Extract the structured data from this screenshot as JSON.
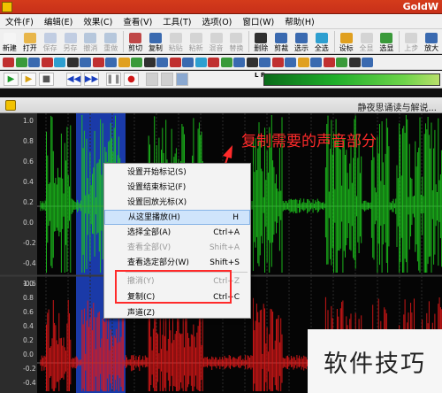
{
  "app": {
    "title": "GoldW"
  },
  "menu": [
    "文件(F)",
    "编辑(E)",
    "效果(C)",
    "查看(V)",
    "工具(T)",
    "选项(O)",
    "窗口(W)",
    "帮助(H)"
  ],
  "toolbar": [
    {
      "label": "新建",
      "enabled": true,
      "color": "#f5f5f5"
    },
    {
      "label": "打开",
      "enabled": true,
      "color": "#e8b64a"
    },
    {
      "label": "保存",
      "enabled": false,
      "color": "#6a8cc8"
    },
    {
      "label": "另存",
      "enabled": false,
      "color": "#6a8cc8"
    },
    {
      "label": "撤消",
      "enabled": false,
      "color": "#4a7ab8"
    },
    {
      "label": "重做",
      "enabled": false,
      "color": "#4a7ab8"
    },
    {
      "label": "剪切",
      "enabled": true,
      "color": "#c04848"
    },
    {
      "label": "复制",
      "enabled": true,
      "color": "#3a6ab0"
    },
    {
      "label": "粘贴",
      "enabled": false,
      "color": "#a0a0a0"
    },
    {
      "label": "粘新",
      "enabled": false,
      "color": "#a0a0a0"
    },
    {
      "label": "混音",
      "enabled": false,
      "color": "#a0a0a0"
    },
    {
      "label": "替换",
      "enabled": false,
      "color": "#a0a0a0"
    },
    {
      "label": "删除",
      "enabled": true,
      "color": "#303030"
    },
    {
      "label": "剪裁",
      "enabled": true,
      "color": "#3a6ab0"
    },
    {
      "label": "选示",
      "enabled": true,
      "color": "#3a6ab0"
    },
    {
      "label": "全选",
      "enabled": true,
      "color": "#2e9fd0"
    },
    {
      "label": "设标",
      "enabled": true,
      "color": "#e0a020"
    },
    {
      "label": "全显",
      "enabled": false,
      "color": "#a0a0a0"
    },
    {
      "label": "选显",
      "enabled": true,
      "color": "#3a9a3a"
    },
    {
      "label": "上步",
      "enabled": false,
      "color": "#a0a0a0"
    },
    {
      "label": "放大",
      "enabled": true,
      "color": "#3a6ab0"
    }
  ],
  "effects_icons": [
    "#c03030",
    "#3a9a3a",
    "#3a6ab0",
    "#c03030",
    "#2e9fd0",
    "#303030",
    "#3a6ab0",
    "#c03030",
    "#3a6ab0",
    "#e0a020",
    "#3a9a3a",
    "#303030",
    "#3a6ab0",
    "#c03030",
    "#3a6ab0",
    "#2e9fd0",
    "#c03030",
    "#3a9a3a",
    "#3a6ab0",
    "#303030",
    "#3a6ab0",
    "#c03030",
    "#3a6ab0",
    "#e0a020",
    "#3a6ab0",
    "#c03030",
    "#3a9a3a",
    "#303030",
    "#3a6ab0"
  ],
  "transport": [
    {
      "name": "play",
      "glyph": "▶",
      "color": "#1e9a2a"
    },
    {
      "name": "play-selection",
      "glyph": "▶",
      "color": "#d8a010"
    },
    {
      "name": "stop",
      "glyph": "■",
      "color": "#555555"
    },
    {
      "name": "rewind",
      "glyph": "◀◀",
      "color": "#1a40c0"
    },
    {
      "name": "fast-forward",
      "glyph": "▶▶",
      "color": "#1a40c0"
    },
    {
      "name": "pause",
      "glyph": "❚❚",
      "color": "#888888"
    },
    {
      "name": "record",
      "glyph": "●",
      "color": "#d01818"
    }
  ],
  "meter_label": "L R",
  "document": {
    "title": "静夜思诵读与解说..."
  },
  "waveform": {
    "top_channel_color": "#1ec81e",
    "bottom_channel_color": "#e01818",
    "selection_color": "#1a3aa8",
    "top_axis": [
      "1.0",
      "0.8",
      "0.6",
      "0.4",
      "0.2",
      "0.0",
      "-0.2",
      "-0.4",
      "-0.6"
    ],
    "bottom_axis": [
      "1.0",
      "0.8",
      "0.6",
      "0.4",
      "0.2",
      "0.0",
      "-0.2",
      "-0.4"
    ]
  },
  "annotation": {
    "text": "复制需要的声音部分",
    "color": "#ff2a2a"
  },
  "context_menu": [
    {
      "label": "设置开始标记(S)",
      "shortcut": "",
      "enabled": true,
      "highlight": false
    },
    {
      "label": "设置结束标记(F)",
      "shortcut": "",
      "enabled": true,
      "highlight": false
    },
    {
      "label": "设置回放光标(X)",
      "shortcut": "",
      "enabled": true,
      "highlight": false
    },
    {
      "label": "从这里播放(H)",
      "shortcut": "H",
      "enabled": true,
      "highlight": true
    },
    {
      "label": "选择全部(A)",
      "shortcut": "Ctrl+A",
      "enabled": true,
      "highlight": false
    },
    {
      "label": "查看全部(V)",
      "shortcut": "Shift+A",
      "enabled": false,
      "highlight": false
    },
    {
      "label": "查看选定部分(W)",
      "shortcut": "Shift+S",
      "enabled": true,
      "highlight": false
    },
    {
      "label": "撤消(Y)",
      "shortcut": "Ctrl+Z",
      "enabled": false,
      "highlight": false
    },
    {
      "label": "复制(C)",
      "shortcut": "Ctrl+C",
      "enabled": true,
      "highlight": false
    },
    {
      "label": "声道(Z)",
      "shortcut": "",
      "enabled": true,
      "highlight": false
    }
  ],
  "watermark": {
    "text": "软件技巧"
  }
}
